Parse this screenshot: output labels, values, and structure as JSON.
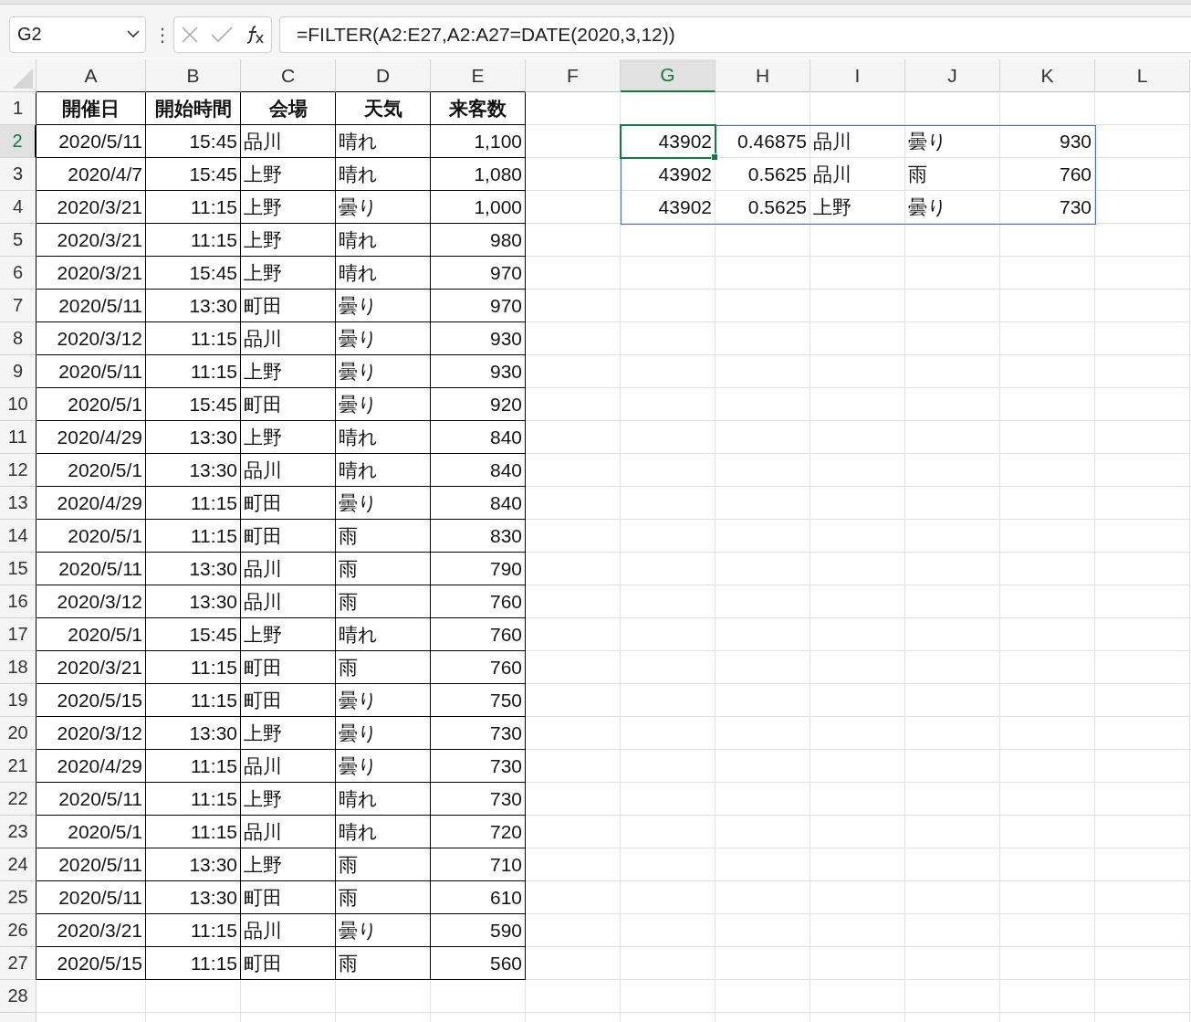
{
  "name_box": {
    "value": "G2"
  },
  "formula_bar": {
    "menu_glyph": "⋮",
    "formula": "=FILTER(A2:E27,A2:A27=DATE(2020,3,12))"
  },
  "columns": [
    {
      "label": "A",
      "selected": false
    },
    {
      "label": "B",
      "selected": false
    },
    {
      "label": "C",
      "selected": false
    },
    {
      "label": "D",
      "selected": false
    },
    {
      "label": "E",
      "selected": false
    },
    {
      "label": "F",
      "selected": false
    },
    {
      "label": "G",
      "selected": true
    },
    {
      "label": "H",
      "selected": false
    },
    {
      "label": "I",
      "selected": false
    },
    {
      "label": "J",
      "selected": false
    },
    {
      "label": "K",
      "selected": false
    },
    {
      "label": "L",
      "selected": false
    }
  ],
  "header_row": {
    "number": "1",
    "selected": false,
    "cells": [
      "開催日",
      "開始時間",
      "会場",
      "天気",
      "来客数"
    ]
  },
  "rows": [
    {
      "number": "2",
      "selected": true,
      "cells": [
        "2020/5/11",
        "15:45",
        "品川",
        "晴れ",
        "1,100"
      ],
      "spill": [
        "43902",
        "0.46875",
        "品川",
        "曇り",
        "930"
      ]
    },
    {
      "number": "3",
      "selected": false,
      "cells": [
        "2020/4/7",
        "15:45",
        "上野",
        "晴れ",
        "1,080"
      ],
      "spill": [
        "43902",
        "0.5625",
        "品川",
        "雨",
        "760"
      ]
    },
    {
      "number": "4",
      "selected": false,
      "cells": [
        "2020/3/21",
        "11:15",
        "上野",
        "曇り",
        "1,000"
      ],
      "spill": [
        "43902",
        "0.5625",
        "上野",
        "曇り",
        "730"
      ]
    },
    {
      "number": "5",
      "selected": false,
      "cells": [
        "2020/3/21",
        "11:15",
        "上野",
        "晴れ",
        "980"
      ]
    },
    {
      "number": "6",
      "selected": false,
      "cells": [
        "2020/3/21",
        "15:45",
        "上野",
        "晴れ",
        "970"
      ]
    },
    {
      "number": "7",
      "selected": false,
      "cells": [
        "2020/5/11",
        "13:30",
        "町田",
        "曇り",
        "970"
      ]
    },
    {
      "number": "8",
      "selected": false,
      "cells": [
        "2020/3/12",
        "11:15",
        "品川",
        "曇り",
        "930"
      ]
    },
    {
      "number": "9",
      "selected": false,
      "cells": [
        "2020/5/11",
        "11:15",
        "上野",
        "曇り",
        "930"
      ]
    },
    {
      "number": "10",
      "selected": false,
      "cells": [
        "2020/5/1",
        "15:45",
        "町田",
        "曇り",
        "920"
      ]
    },
    {
      "number": "11",
      "selected": false,
      "cells": [
        "2020/4/29",
        "13:30",
        "上野",
        "晴れ",
        "840"
      ]
    },
    {
      "number": "12",
      "selected": false,
      "cells": [
        "2020/5/1",
        "13:30",
        "品川",
        "晴れ",
        "840"
      ]
    },
    {
      "number": "13",
      "selected": false,
      "cells": [
        "2020/4/29",
        "11:15",
        "町田",
        "曇り",
        "840"
      ]
    },
    {
      "number": "14",
      "selected": false,
      "cells": [
        "2020/5/1",
        "11:15",
        "町田",
        "雨",
        "830"
      ]
    },
    {
      "number": "15",
      "selected": false,
      "cells": [
        "2020/5/11",
        "13:30",
        "品川",
        "雨",
        "790"
      ]
    },
    {
      "number": "16",
      "selected": false,
      "cells": [
        "2020/3/12",
        "13:30",
        "品川",
        "雨",
        "760"
      ]
    },
    {
      "number": "17",
      "selected": false,
      "cells": [
        "2020/5/1",
        "15:45",
        "上野",
        "晴れ",
        "760"
      ]
    },
    {
      "number": "18",
      "selected": false,
      "cells": [
        "2020/3/21",
        "11:15",
        "町田",
        "雨",
        "760"
      ]
    },
    {
      "number": "19",
      "selected": false,
      "cells": [
        "2020/5/15",
        "11:15",
        "町田",
        "曇り",
        "750"
      ]
    },
    {
      "number": "20",
      "selected": false,
      "cells": [
        "2020/3/12",
        "13:30",
        "上野",
        "曇り",
        "730"
      ]
    },
    {
      "number": "21",
      "selected": false,
      "cells": [
        "2020/4/29",
        "11:15",
        "品川",
        "曇り",
        "730"
      ]
    },
    {
      "number": "22",
      "selected": false,
      "cells": [
        "2020/5/11",
        "11:15",
        "上野",
        "晴れ",
        "730"
      ]
    },
    {
      "number": "23",
      "selected": false,
      "cells": [
        "2020/5/1",
        "11:15",
        "品川",
        "晴れ",
        "720"
      ]
    },
    {
      "number": "24",
      "selected": false,
      "cells": [
        "2020/5/11",
        "13:30",
        "上野",
        "雨",
        "710"
      ]
    },
    {
      "number": "25",
      "selected": false,
      "cells": [
        "2020/5/11",
        "13:30",
        "町田",
        "雨",
        "610"
      ]
    },
    {
      "number": "26",
      "selected": false,
      "cells": [
        "2020/3/21",
        "11:15",
        "品川",
        "曇り",
        "590"
      ]
    },
    {
      "number": "27",
      "selected": false,
      "cells": [
        "2020/5/15",
        "11:15",
        "町田",
        "雨",
        "560"
      ]
    },
    {
      "number": "28",
      "selected": false
    }
  ]
}
